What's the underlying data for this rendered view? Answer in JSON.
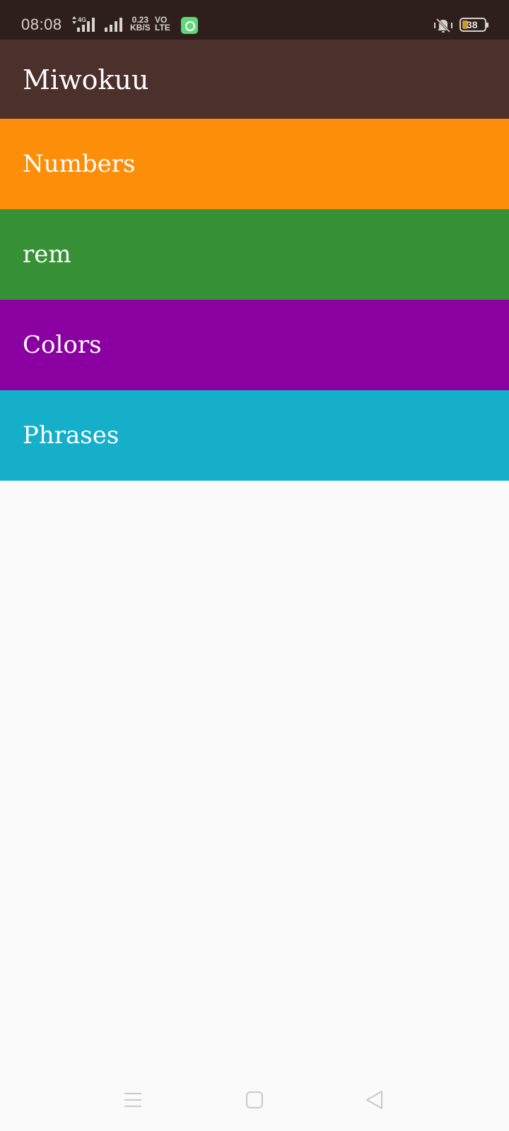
{
  "status_bar": {
    "time": "08:08",
    "network_type": "4G",
    "data_speed_value": "0.23",
    "data_speed_unit": "KB/S",
    "volte_line1": "VO",
    "volte_line2": "LTE",
    "battery_level": "38",
    "icons": [
      "signal-icon",
      "signal-icon",
      "app-notification-icon",
      "vibrate-mute-icon",
      "battery-icon"
    ]
  },
  "app_bar": {
    "title": "Miwokuu"
  },
  "categories": [
    {
      "label": "Numbers",
      "color": "#fd8e09"
    },
    {
      "label": "rem",
      "color": "#379237"
    },
    {
      "label": "Colors",
      "color": "#8a00a1"
    },
    {
      "label": "Phrases",
      "color": "#16afca"
    }
  ],
  "nav_bar": {
    "icons": [
      "menu-icon",
      "home-icon",
      "back-icon"
    ]
  },
  "colors": {
    "status_bar": "#2f1f1c",
    "app_bar": "#4b302b",
    "background": "#fafafa"
  }
}
